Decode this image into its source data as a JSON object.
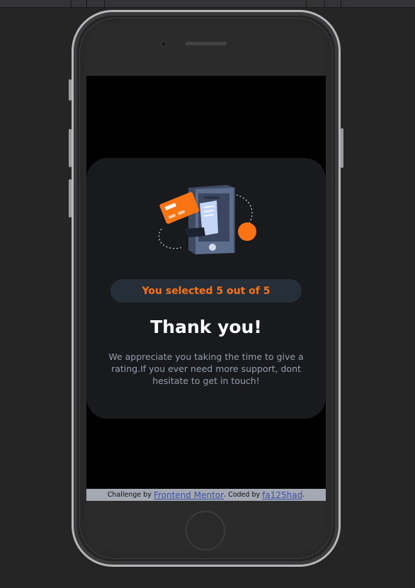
{
  "card": {
    "selection_text": "You selected 5 out of 5",
    "title": "Thank you!",
    "message": "We appreciate you taking the time to give a rating.If you ever need more support, dont hesitate to get in touch!"
  },
  "attribution": {
    "prefix": "Challenge by",
    "link1": "Frontend Mentor",
    "middle": ". Coded by",
    "link2": "fa125had",
    "suffix": "."
  },
  "colors": {
    "accent": "#fb7413",
    "card_bg": "#181a1d",
    "pill_bg": "#262e38",
    "text_muted": "#959eac"
  },
  "icons": [
    "payment-illustration-icon"
  ]
}
